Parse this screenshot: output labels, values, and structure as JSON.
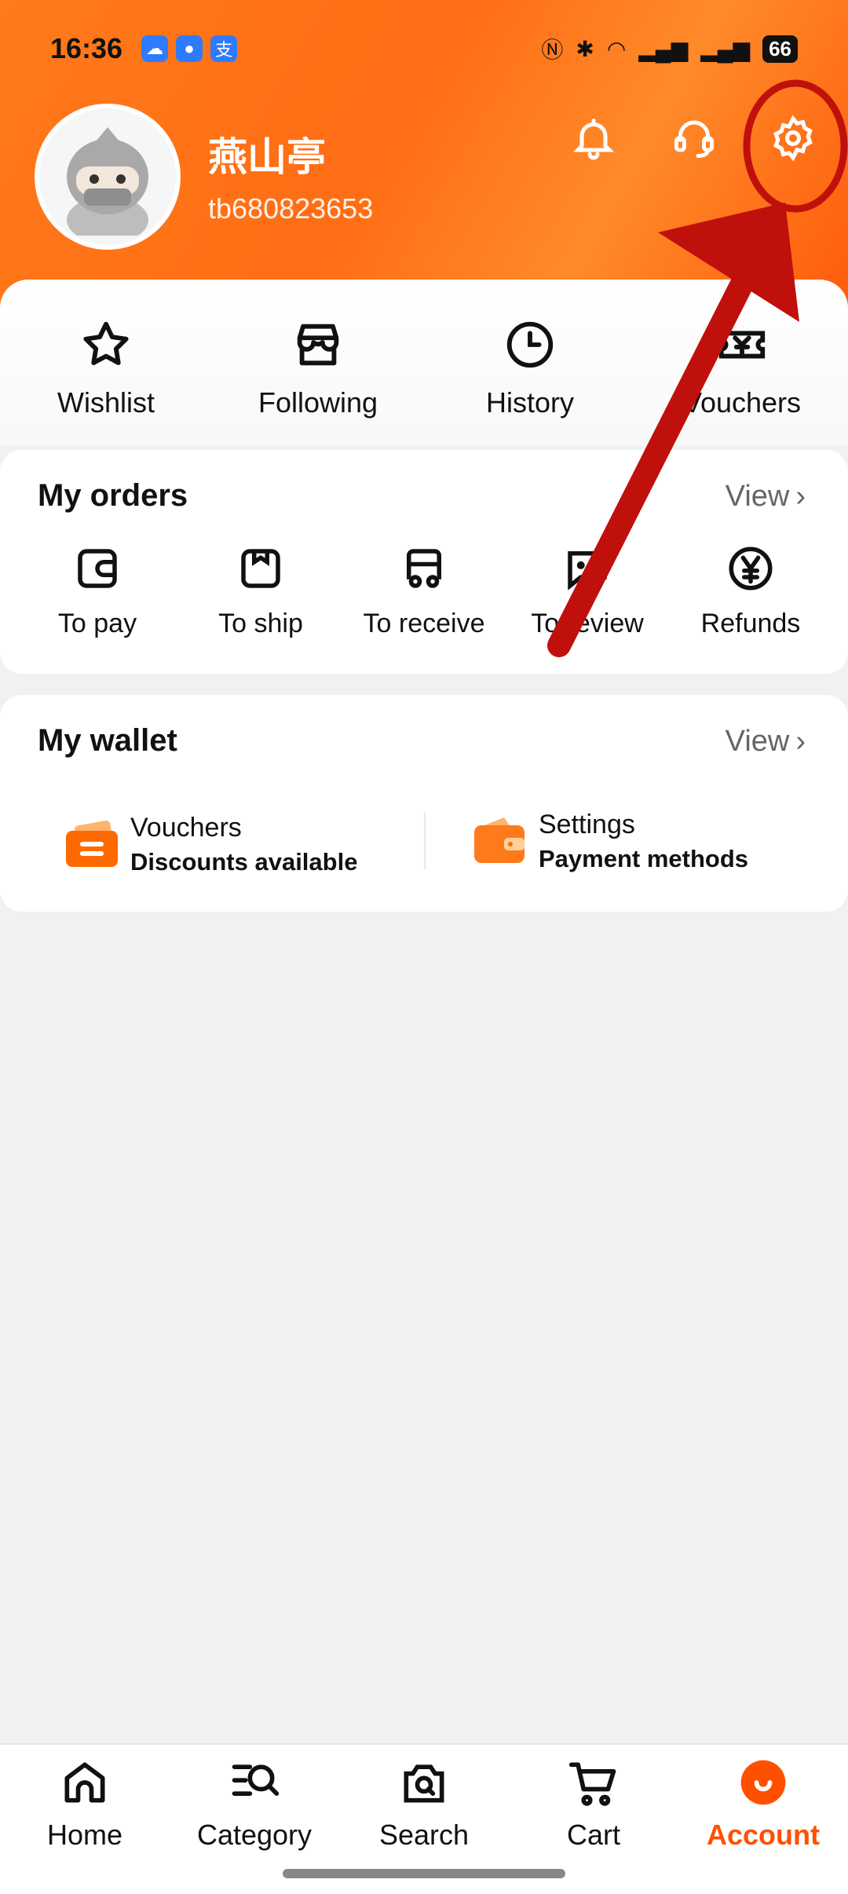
{
  "status_bar": {
    "time": "16:36",
    "battery": "66"
  },
  "header": {
    "username": "燕山亭",
    "user_id": "tb680823653"
  },
  "quick_links": [
    {
      "label": "Wishlist",
      "icon": "star-icon"
    },
    {
      "label": "Following",
      "icon": "store-icon"
    },
    {
      "label": "History",
      "icon": "clock-icon"
    },
    {
      "label": "Vouchers",
      "icon": "voucher-icon"
    }
  ],
  "orders": {
    "title": "My orders",
    "view_label": "View",
    "items": [
      {
        "label": "To pay",
        "icon": "wallet-icon"
      },
      {
        "label": "To ship",
        "icon": "package-icon"
      },
      {
        "label": "To receive",
        "icon": "truck-icon"
      },
      {
        "label": "To review",
        "icon": "chat-icon"
      },
      {
        "label": "Refunds",
        "icon": "yen-icon"
      }
    ]
  },
  "wallet": {
    "title": "My wallet",
    "view_label": "View",
    "items": [
      {
        "title": "Vouchers",
        "subtitle": "Discounts available"
      },
      {
        "title": "Settings",
        "subtitle": "Payment methods"
      }
    ]
  },
  "bottom_nav": [
    {
      "label": "Home"
    },
    {
      "label": "Category"
    },
    {
      "label": "Search"
    },
    {
      "label": "Cart"
    },
    {
      "label": "Account"
    }
  ],
  "colors": {
    "brand": "#ff5000",
    "annotation": "#c0100c"
  }
}
